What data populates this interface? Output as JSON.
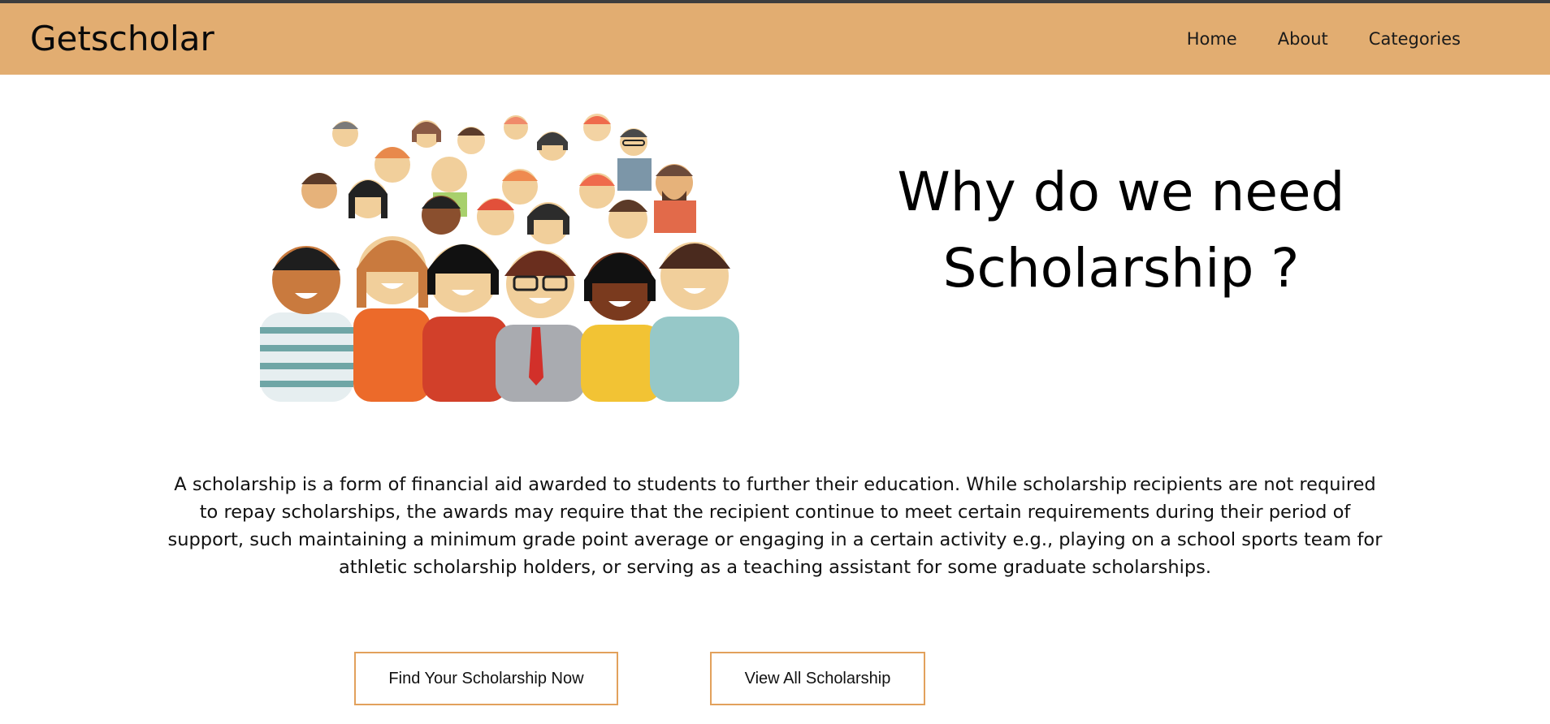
{
  "brand": "Getscholar",
  "nav": {
    "home": "Home",
    "about": "About",
    "categories": "Categories"
  },
  "hero": {
    "image_name": "crowd-of-students-illustration",
    "heading_line1": "Why do we need",
    "heading_line2": "Scholarship ?"
  },
  "description": "A scholarship is a form of financial aid awarded to students to further their education. While scholarship recipients are not required to repay scholarships, the awards may require that the recipient continue to meet certain requirements during their period of support, such maintaining a minimum grade point average or engaging in a certain activity e.g., playing on a school sports team for athletic scholarship holders, or serving as a teaching assistant for some graduate scholarships.",
  "buttons": {
    "find": "Find Your Scholarship Now",
    "view_all": "View All Scholarship"
  },
  "colors": {
    "navbar": "#e2ad71",
    "button_border": "#e2a15c",
    "topline": "#3d3d3d"
  }
}
